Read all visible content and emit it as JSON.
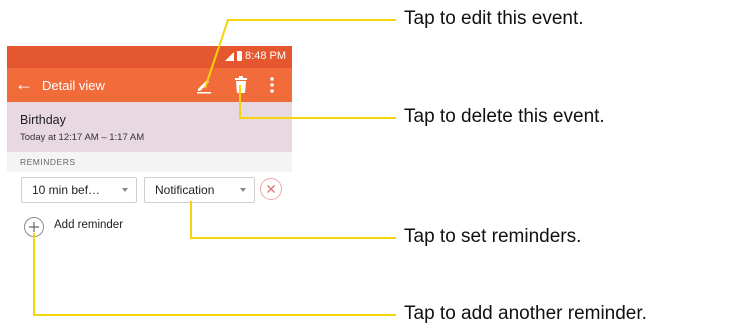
{
  "status_bar": {
    "time": "8:48 PM"
  },
  "app_bar": {
    "title": "Detail view"
  },
  "event": {
    "title": "Birthday",
    "time": "Today at 12:17 AM – 1:17 AM"
  },
  "reminders": {
    "section_label": "REMINDERS",
    "time_option": "10 min bef…",
    "method_option": "Notification",
    "add_label": "Add reminder"
  },
  "callouts": {
    "edit": "Tap to edit this event.",
    "delete": "Tap to delete this event.",
    "reminders": "Tap to set reminders.",
    "add": "Tap to add another reminder."
  },
  "colors": {
    "status_bar": "#e5572f",
    "app_bar": "#f26b3a",
    "event_header": "#e8d8e2",
    "callout_line": "#f5d40c",
    "remove_accent": "#e57373"
  },
  "icons": [
    "back-arrow-icon",
    "edit-pencil-icon",
    "trash-icon",
    "more-vert-icon",
    "signal-icon",
    "battery-icon",
    "close-icon",
    "plus-icon"
  ]
}
